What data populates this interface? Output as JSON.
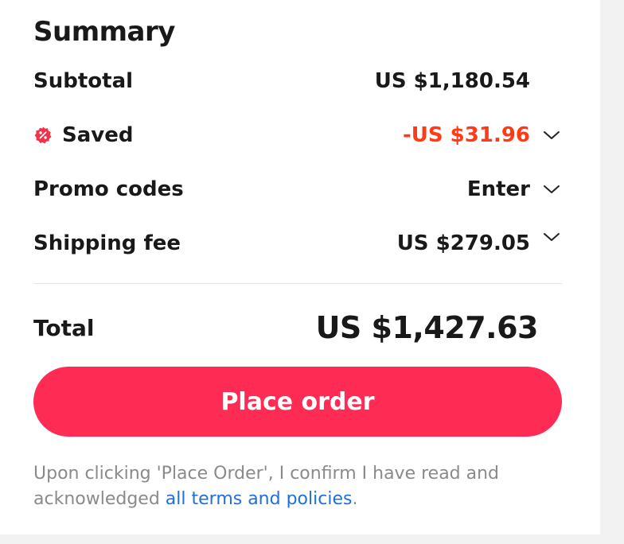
{
  "summary": {
    "title": "Summary",
    "subtotal": {
      "label": "Subtotal",
      "value": "US $1,180.54"
    },
    "saved": {
      "label": "Saved",
      "value": "-US $31.96",
      "badge_icon": "percent-badge-icon",
      "color": "#fd3c17"
    },
    "promo": {
      "label": "Promo codes",
      "value": "Enter"
    },
    "shipping": {
      "label": "Shipping fee",
      "value": "US $279.05"
    },
    "total": {
      "label": "Total",
      "value": "US $1,427.63"
    }
  },
  "place_order": {
    "label": "Place order",
    "color": "#fe2c55"
  },
  "terms": {
    "text": "Upon clicking 'Place Order', I confirm I have read and acknowledged ",
    "link": "all terms and policies",
    "suffix": "."
  }
}
